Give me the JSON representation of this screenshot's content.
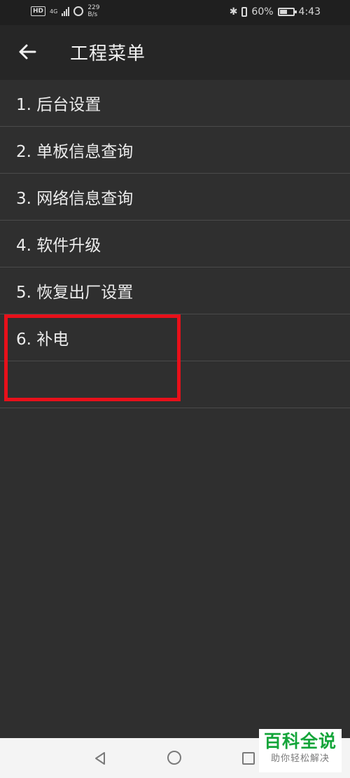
{
  "status_bar": {
    "hd": "HD",
    "network": "4G",
    "speed_value": "229",
    "speed_unit": "B/s",
    "battery_percent_text": "60%",
    "battery_level": 0.6,
    "time": "4:43",
    "bluetooth_icon": "bluetooth-icon",
    "vibrate_icon": "vibrate-icon"
  },
  "app_bar": {
    "back_icon": "arrow-left-icon",
    "title": "工程菜单"
  },
  "menu": {
    "items": [
      {
        "label": "1. 后台设置"
      },
      {
        "label": "2. 单板信息查询"
      },
      {
        "label": "3. 网络信息查询"
      },
      {
        "label": "4. 软件升级"
      },
      {
        "label": "5. 恢复出厂设置"
      },
      {
        "label": "6. 补电"
      },
      {
        "label": ""
      }
    ]
  },
  "highlight": {
    "color": "#e8101a"
  },
  "nav_bar": {
    "back_icon": "triangle-back-icon",
    "home_icon": "circle-home-icon",
    "recent_icon": "square-recent-icon"
  },
  "watermark": {
    "title": "百科全说",
    "subtitle": "助你轻松解决"
  }
}
